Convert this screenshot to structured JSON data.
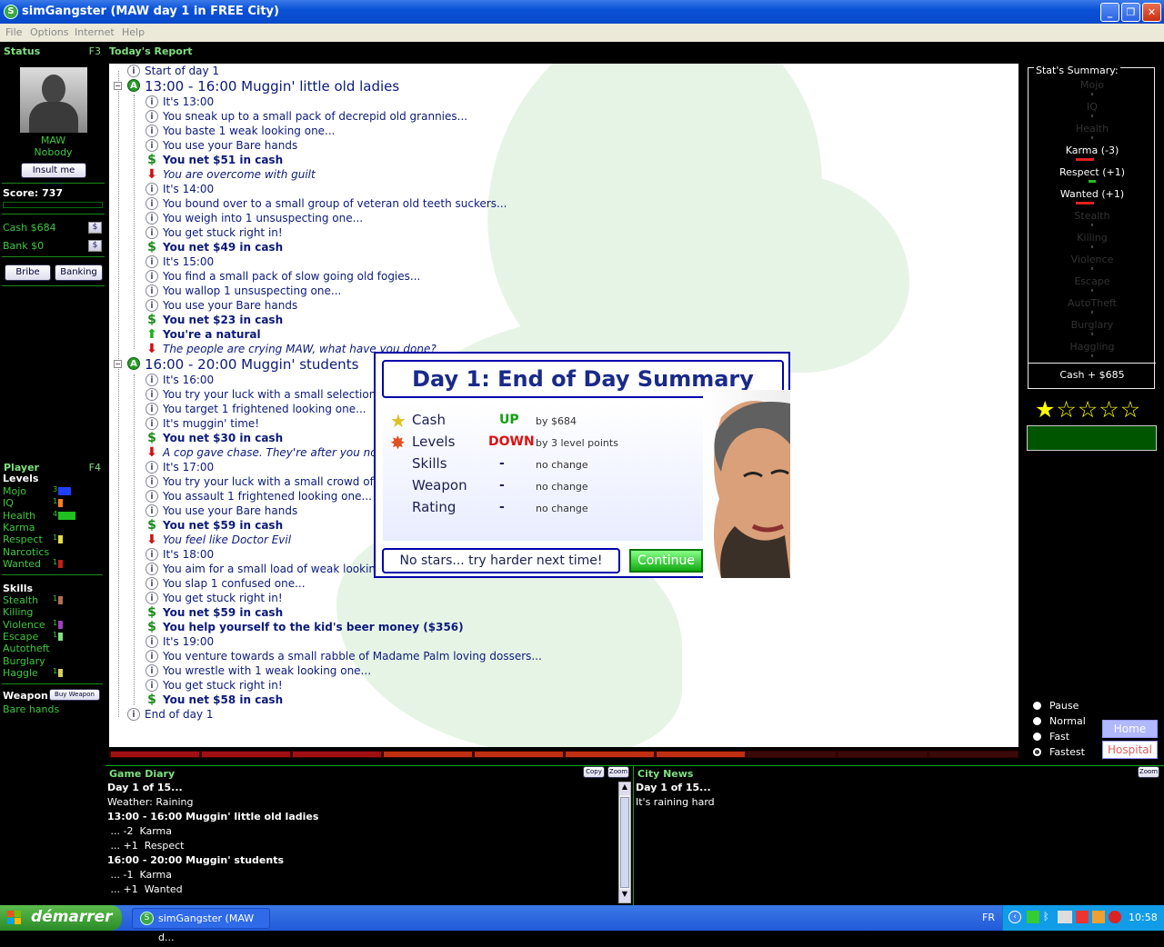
{
  "window": {
    "title": "simGangster (MAW day 1 in FREE City)"
  },
  "menu": [
    "File",
    "Options",
    "Internet",
    "Help"
  ],
  "status": {
    "header": "Status",
    "hotkey": "F3",
    "name": "MAW",
    "rank": "Nobody",
    "insult_button": "Insult me now!",
    "score_label": "Score: 737",
    "cash": "Cash $684",
    "cash_btn": "$",
    "bank": "Bank $0",
    "bank_btn": "$",
    "bribe": "Bribe",
    "banking": "Banking"
  },
  "player": {
    "header": "Player",
    "hotkey": "F4",
    "levels_title": "Levels",
    "levels": [
      {
        "label": "Mojo",
        "value": "3",
        "color": "#2040ff"
      },
      {
        "label": "IQ",
        "value": "1",
        "color": "#ff8020"
      },
      {
        "label": "Health",
        "value": "4",
        "color": "#20c020"
      },
      {
        "label": "Karma",
        "value": "",
        "color": ""
      },
      {
        "label": "Respect",
        "value": "1",
        "color": "#e0e040"
      },
      {
        "label": "Narcotics",
        "value": "",
        "color": ""
      },
      {
        "label": "Wanted",
        "value": "1",
        "color": "#c02020"
      }
    ],
    "skills_title": "Skills",
    "skills": [
      {
        "label": "Stealth",
        "value": "1",
        "color": "#b07050"
      },
      {
        "label": "Killing",
        "value": "",
        "color": ""
      },
      {
        "label": "Violence",
        "value": "1",
        "color": "#a040c0"
      },
      {
        "label": "Escape",
        "value": "1",
        "color": "#80e080"
      },
      {
        "label": "Autotheft",
        "value": "",
        "color": ""
      },
      {
        "label": "Burglary",
        "value": "",
        "color": ""
      },
      {
        "label": "Haggle",
        "value": "1",
        "color": "#d0d060"
      }
    ],
    "weapon_title": "Weapon",
    "buy_weapon": "Buy Weapon",
    "weapon": "Bare hands"
  },
  "report": {
    "header": "Today's Report",
    "rows": [
      {
        "icon": "i",
        "text": "Start of day 1",
        "style": "",
        "level": 1
      },
      {
        "icon": "a",
        "text": "13:00 - 16:00 Muggin' little old ladies",
        "style": "big",
        "level": 0
      },
      {
        "icon": "i",
        "text": "It's 13:00",
        "style": "",
        "level": 2
      },
      {
        "icon": "i",
        "text": "You sneak up to a small pack of decrepid old grannies...",
        "style": "",
        "level": 2
      },
      {
        "icon": "i",
        "text": "You baste 1 weak looking one...",
        "style": "",
        "level": 2
      },
      {
        "icon": "i",
        "text": "You use your Bare hands",
        "style": "",
        "level": 2
      },
      {
        "icon": "d",
        "text": "You net $51 in cash",
        "style": "bold",
        "level": 2
      },
      {
        "icon": "dn",
        "text": "You are overcome with guilt",
        "style": "ital",
        "level": 2
      },
      {
        "icon": "i",
        "text": "It's 14:00",
        "style": "",
        "level": 2
      },
      {
        "icon": "i",
        "text": "You bound over to a small group of veteran old teeth suckers...",
        "style": "",
        "level": 2
      },
      {
        "icon": "i",
        "text": "You weigh into 1 unsuspecting one...",
        "style": "",
        "level": 2
      },
      {
        "icon": "i",
        "text": "You get stuck right in!",
        "style": "",
        "level": 2
      },
      {
        "icon": "d",
        "text": "You net $49 in cash",
        "style": "bold",
        "level": 2
      },
      {
        "icon": "i",
        "text": "It's 15:00",
        "style": "",
        "level": 2
      },
      {
        "icon": "i",
        "text": "You find a small pack of slow going old fogies...",
        "style": "",
        "level": 2
      },
      {
        "icon": "i",
        "text": "You wallop 1 unsuspecting one...",
        "style": "",
        "level": 2
      },
      {
        "icon": "i",
        "text": "You use your Bare hands",
        "style": "",
        "level": 2
      },
      {
        "icon": "d",
        "text": "You net $23 in cash",
        "style": "bold",
        "level": 2
      },
      {
        "icon": "up",
        "text": "You're a natural",
        "style": "bold",
        "level": 2
      },
      {
        "icon": "dn",
        "text": "The people are crying MAW, what have you done?",
        "style": "ital",
        "level": 2
      },
      {
        "icon": "a",
        "text": "16:00 - 20:00 Muggin' students",
        "style": "big",
        "level": 0
      },
      {
        "icon": "i",
        "text": "It's 16:00",
        "style": "",
        "level": 2
      },
      {
        "icon": "i",
        "text": "You try your luck with a small selection of",
        "style": "",
        "level": 2
      },
      {
        "icon": "i",
        "text": "You target 1 frightened looking one...",
        "style": "",
        "level": 2
      },
      {
        "icon": "i",
        "text": "It's muggin' time!",
        "style": "",
        "level": 2
      },
      {
        "icon": "d",
        "text": "You net $30 in cash",
        "style": "bold",
        "level": 2
      },
      {
        "icon": "dn",
        "text": "A cop gave chase.  They're after you now",
        "style": "ital",
        "level": 2
      },
      {
        "icon": "i",
        "text": "It's 17:00",
        "style": "",
        "level": 2
      },
      {
        "icon": "i",
        "text": "You try your luck with a small crowd of sad",
        "style": "",
        "level": 2
      },
      {
        "icon": "i",
        "text": "You assault 1 frightened looking one...",
        "style": "",
        "level": 2
      },
      {
        "icon": "i",
        "text": "You use your Bare hands",
        "style": "",
        "level": 2
      },
      {
        "icon": "d",
        "text": "You net $59 in cash",
        "style": "bold",
        "level": 2
      },
      {
        "icon": "dn",
        "text": "You feel like Doctor Evil",
        "style": "ital",
        "level": 2
      },
      {
        "icon": "i",
        "text": "It's 18:00",
        "style": "",
        "level": 2
      },
      {
        "icon": "i",
        "text": "You aim for a small load of weak looking ba",
        "style": "",
        "level": 2
      },
      {
        "icon": "i",
        "text": "You slap 1 confused one...",
        "style": "",
        "level": 2
      },
      {
        "icon": "i",
        "text": "You get stuck right in!",
        "style": "",
        "level": 2
      },
      {
        "icon": "d",
        "text": "You net $59 in cash",
        "style": "bold",
        "level": 2
      },
      {
        "icon": "d",
        "text": "You help yourself to the kid's beer money ($356)",
        "style": "bold",
        "level": 2
      },
      {
        "icon": "i",
        "text": "It's 19:00",
        "style": "",
        "level": 2
      },
      {
        "icon": "i",
        "text": "You venture towards a small rabble of Madame Palm loving dossers...",
        "style": "",
        "level": 2
      },
      {
        "icon": "i",
        "text": "You wrestle with 1 weak looking one...",
        "style": "",
        "level": 2
      },
      {
        "icon": "i",
        "text": "You get stuck right in!",
        "style": "",
        "level": 2
      },
      {
        "icon": "d",
        "text": "You net $58 in cash",
        "style": "bold",
        "level": 2
      },
      {
        "icon": "i",
        "text": "End of day 1",
        "style": "",
        "level": 1
      }
    ],
    "progress_filled": 7,
    "progress_total": 10
  },
  "stats": {
    "title": "Stat's Summary:",
    "items": [
      {
        "label": "Mojo",
        "active": false,
        "bar": ""
      },
      {
        "label": "IQ",
        "active": false,
        "bar": ""
      },
      {
        "label": "Health",
        "active": false,
        "bar": ""
      },
      {
        "label": "Karma (-3)",
        "active": true,
        "bar": "#e02020"
      },
      {
        "label": "Respect (+1)",
        "active": true,
        "bar": "#20c020"
      },
      {
        "label": "Wanted (+1)",
        "active": true,
        "bar": "#e02020"
      },
      {
        "label": "Stealth",
        "active": false,
        "bar": ""
      },
      {
        "label": "Killing",
        "active": false,
        "bar": ""
      },
      {
        "label": "Violence",
        "active": false,
        "bar": ""
      },
      {
        "label": "Escape",
        "active": false,
        "bar": ""
      },
      {
        "label": "AutoTheft",
        "active": false,
        "bar": ""
      },
      {
        "label": "Burglary",
        "active": false,
        "bar": ""
      },
      {
        "label": "Haggling",
        "active": false,
        "bar": ""
      }
    ],
    "cash_summary": "Cash + $685",
    "stars_filled": 1,
    "stars_total": 5
  },
  "speed": {
    "options": [
      "Pause",
      "Normal",
      "Fast",
      "Fastest"
    ],
    "selected": "Fastest"
  },
  "nav": {
    "home": "Home",
    "hospital": "Hospital"
  },
  "diary": {
    "header": "Game Diary",
    "copy": "Copy",
    "zoom": "Zoom",
    "lines": [
      {
        "text": "Day 1 of 15...",
        "bold": true
      },
      {
        "text": "Weather: Raining",
        "bold": false
      },
      {
        "text": "13:00 - 16:00 Muggin' little old ladies",
        "bold": true
      },
      {
        "text": " ... -2  Karma",
        "bold": false
      },
      {
        "text": " ... +1  Respect",
        "bold": false
      },
      {
        "text": "16:00 - 20:00 Muggin' students",
        "bold": true
      },
      {
        "text": " ... -1  Karma",
        "bold": false
      },
      {
        "text": " ... +1  Wanted",
        "bold": false
      }
    ]
  },
  "news": {
    "header": "City News",
    "zoom": "Zoom",
    "lines": [
      {
        "text": "Day 1 of 15...",
        "bold": true
      },
      {
        "text": "It's raining hard",
        "bold": false
      }
    ]
  },
  "dialog": {
    "title": "Day 1: End of Day Summary",
    "rows": [
      {
        "label": "Cash",
        "result": "UP",
        "result_color": "#10a010",
        "note": "by $684",
        "icon": "star"
      },
      {
        "label": "Levels",
        "result": "DOWN",
        "result_color": "#e01010",
        "note": "by 3 level points",
        "icon": "broken-star"
      },
      {
        "label": "Skills",
        "result": "-",
        "result_color": "#1a2050",
        "note": "no change",
        "icon": ""
      },
      {
        "label": "Weapon",
        "result": "-",
        "result_color": "#1a2050",
        "note": "no change",
        "icon": ""
      },
      {
        "label": "Rating",
        "result": "-",
        "result_color": "#1a2050",
        "note": "no change",
        "icon": ""
      }
    ],
    "message": "No stars... try harder next time!",
    "continue": "Continue"
  },
  "taskbar": {
    "start": "démarrer",
    "task": "simGangster (MAW d...",
    "lang": "FR",
    "clock": "10:58"
  }
}
